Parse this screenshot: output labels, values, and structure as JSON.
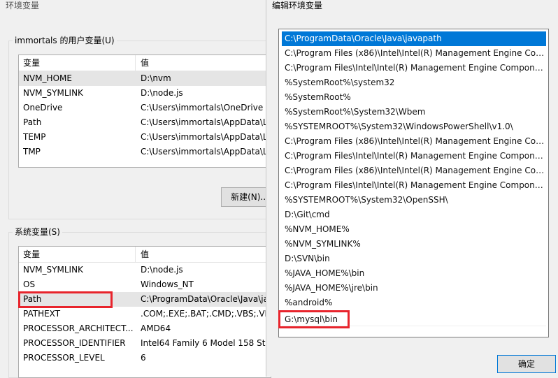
{
  "env_window": {
    "title": "环境变量",
    "user_group_label": "immortals 的用户变量(U)",
    "columns": [
      "变量",
      "值"
    ],
    "user_vars": [
      {
        "name": "NVM_HOME",
        "value": "D:\\nvm"
      },
      {
        "name": "NVM_SYMLINK",
        "value": "D:\\node.js"
      },
      {
        "name": "OneDrive",
        "value": "C:\\Users\\immortals\\OneDrive"
      },
      {
        "name": "Path",
        "value": "C:\\Users\\immortals\\AppData\\L"
      },
      {
        "name": "TEMP",
        "value": "C:\\Users\\immortals\\AppData\\L"
      },
      {
        "name": "TMP",
        "value": "C:\\Users\\immortals\\AppData\\L"
      }
    ],
    "new_button_label": "新建(N)...",
    "system_group_label": "系统变量(S)",
    "system_vars": [
      {
        "name": "NVM_SYMLINK",
        "value": "D:\\node.js"
      },
      {
        "name": "OS",
        "value": "Windows_NT"
      },
      {
        "name": "Path",
        "value": "C:\\ProgramData\\Oracle\\Java\\ja"
      },
      {
        "name": "PATHEXT",
        "value": ".COM;.EXE;.BAT;.CMD;.VBS;.VB"
      },
      {
        "name": "PROCESSOR_ARCHITECT...",
        "value": "AMD64"
      },
      {
        "name": "PROCESSOR_IDENTIFIER",
        "value": "Intel64 Family 6 Model 158 Ste"
      },
      {
        "name": "PROCESSOR_LEVEL",
        "value": "6"
      }
    ]
  },
  "edit_dialog": {
    "title": "编辑环境变量",
    "entries": [
      "C:\\ProgramData\\Oracle\\Java\\javapath",
      "C:\\Program Files (x86)\\Intel\\Intel(R) Management Engine Comp...",
      "C:\\Program Files\\Intel\\Intel(R) Management Engine Component...",
      "%SystemRoot%\\system32",
      "%SystemRoot%",
      "%SystemRoot%\\System32\\Wbem",
      "%SYSTEMROOT%\\System32\\WindowsPowerShell\\v1.0\\",
      "C:\\Program Files (x86)\\Intel\\Intel(R) Management Engine Comp...",
      "C:\\Program Files\\Intel\\Intel(R) Management Engine Component...",
      "C:\\Program Files (x86)\\Intel\\Intel(R) Management Engine Comp...",
      "C:\\Program Files\\Intel\\Intel(R) Management Engine Component...",
      "%SYSTEMROOT%\\System32\\OpenSSH\\",
      "D:\\Git\\cmd",
      "%NVM_HOME%",
      "%NVM_SYMLINK%",
      "D:\\SVN\\bin",
      "%JAVA_HOME%\\bin",
      "%JAVA_HOME%\\jre\\bin",
      "%android%",
      "G:\\mysql\\bin"
    ],
    "ok_button_label": "确定"
  }
}
